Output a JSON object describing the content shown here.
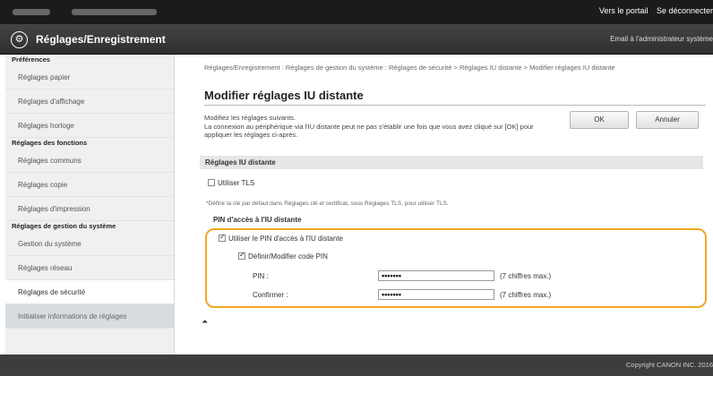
{
  "topbar": {
    "portal_link": "Vers le portail",
    "logout_link": "Se déconnecter"
  },
  "header": {
    "logo_icon": "gear-icon",
    "title": "Réglages/Enregistrement",
    "admin_email": "Email à l'administrateur système"
  },
  "sidebar": {
    "groups": [
      {
        "title": "Préférences",
        "items": [
          "Réglages papier",
          "Réglages d'affichage",
          "Réglages horloge"
        ]
      },
      {
        "title": "Réglages des fonctions",
        "items": [
          "Réglages communs",
          "Réglages copie",
          "Réglages d'impression"
        ]
      },
      {
        "title": "Réglages de gestion du système",
        "items": [
          "Gestion du système",
          "Réglages réseau",
          "Réglages de sécurité"
        ]
      }
    ],
    "last_item": "Initialiser informations de réglages"
  },
  "main": {
    "breadcrumb": "Réglages/Enregistrement : Réglages de gestion du système : Réglages de sécurité > Réglages IU distante > Modifier réglages IU distante",
    "heading": "Modifier réglages IU distante",
    "description_line1": "Modifiez les réglages suivants.",
    "description_line2": "La connexion au périphérique via l'IU distante peut ne pas s'établir une fois que vous avez cliqué sur [OK] pour appliquer les réglages ci-après.",
    "ok_label": "OK",
    "cancel_label": "Annuler",
    "section_title": "Réglages IU distante",
    "use_tls_label": "Utiliser TLS",
    "use_tls_checked": false,
    "tls_note": "*Définir la clé par défaut dans Réglages clé et certificat, sous Réglages TLS, pour utiliser TLS.",
    "pin_section_title": "PIN d'accès à l'IU distante",
    "use_pin_label": "Utiliser le PIN d'accès à l'IU distante",
    "use_pin_checked": true,
    "set_pin_label": "Définir/Modifier code PIN",
    "set_pin_checked": true,
    "pin_label": "PIN :",
    "pin_value": "•••••••",
    "pin_hint": "(7 chiffres max.)",
    "confirm_label": "Confirmer :",
    "confirm_value": "•••••••",
    "confirm_hint": "(7 chiffres max.)",
    "back_to_top_icon": "arrow-top-icon"
  },
  "footer": {
    "copyright": "Copyright CANON INC. 2016"
  },
  "colors": {
    "highlight": "#f5a623",
    "topbar": "#1b1b1b"
  }
}
